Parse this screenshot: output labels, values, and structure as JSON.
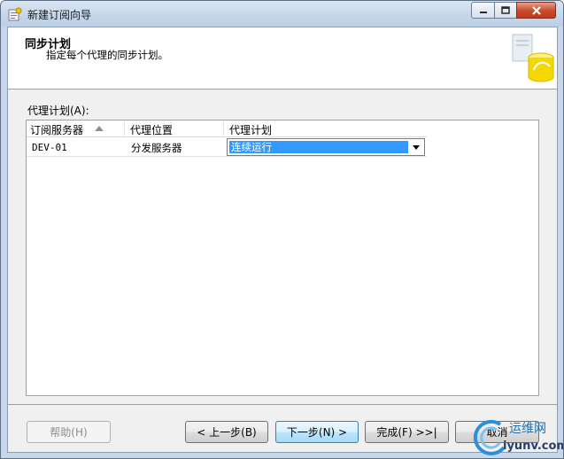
{
  "window": {
    "title": "新建订阅向导"
  },
  "header": {
    "title": "同步计划",
    "subtitle": "指定每个代理的同步计划。"
  },
  "agent_schedule": {
    "label": "代理计划(A):",
    "columns": [
      "订阅服务器",
      "代理位置",
      "代理计划"
    ],
    "rows": [
      {
        "subscriber": "DEV-01",
        "agent_location": "分发服务器",
        "schedule": "连续运行"
      }
    ]
  },
  "buttons": {
    "help": "帮助(H)",
    "back": "< 上一步(B)",
    "next": "下一步(N) >",
    "finish": "完成(F) >>|",
    "cancel": "取消"
  },
  "watermark": {
    "line1": "运维网",
    "line2": "iyunv.com"
  },
  "colors": {
    "selection": "#3399ff",
    "titlebar": "#c4d5e8",
    "close_button": "#c8482c"
  }
}
